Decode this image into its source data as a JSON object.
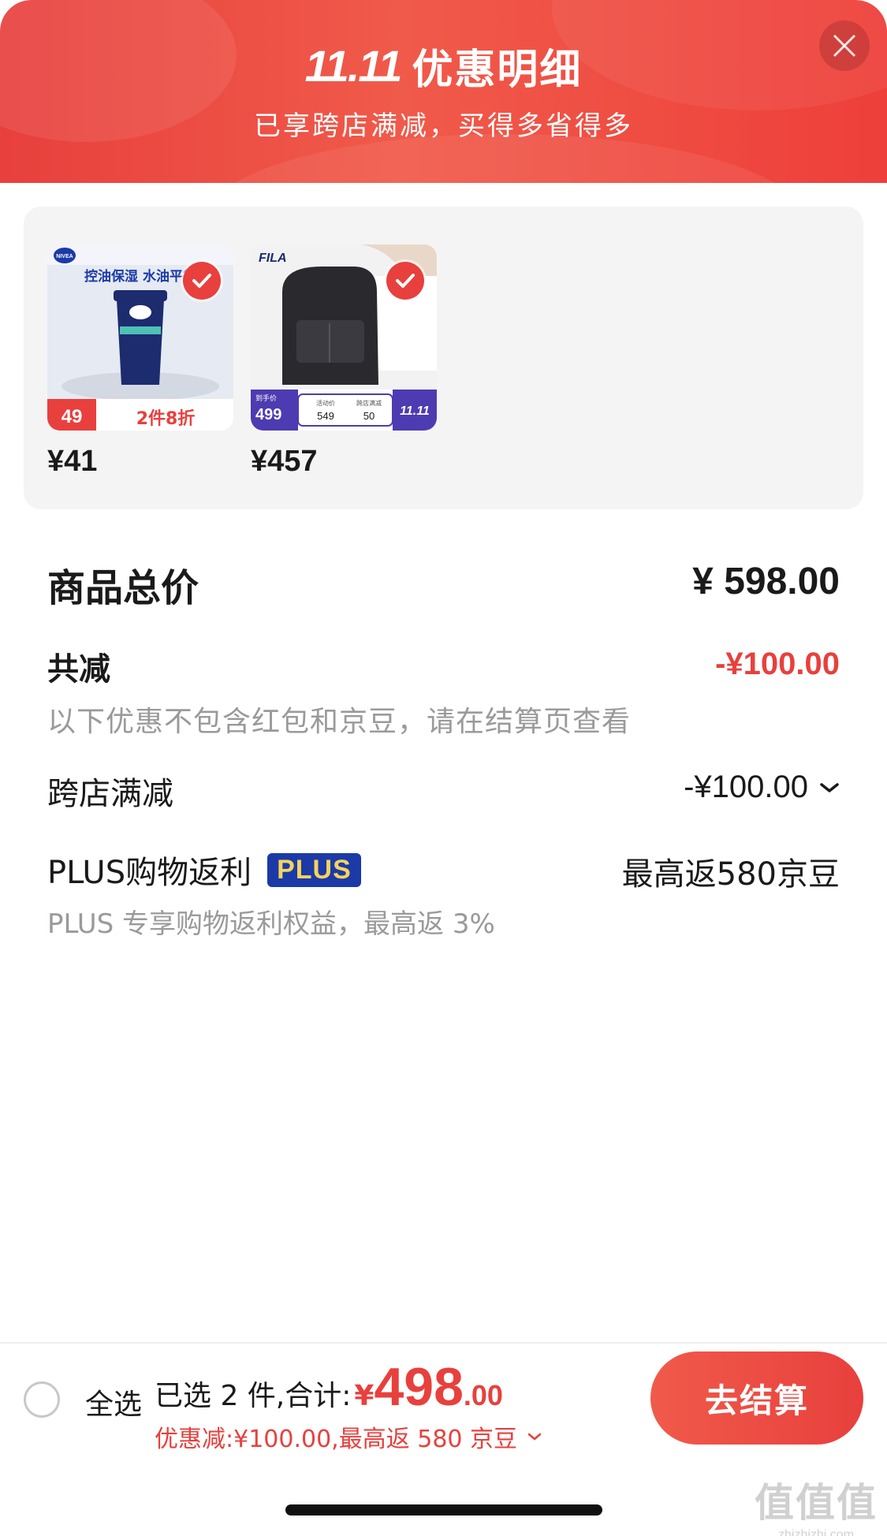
{
  "header": {
    "logo_text": "11.11",
    "title": "优惠明细",
    "subtitle": "已享跨店满减，买得多省得多",
    "close_icon": "close-icon"
  },
  "products": [
    {
      "name": "NIVEA MEN 控油保湿洗面奶",
      "thumb_text": {
        "brand": "NIVEA",
        "headline": "控油保湿 水油平衡",
        "badge_price": "49",
        "promo": "2件8折"
      },
      "price": "¥41",
      "checked": true
    },
    {
      "name": "FILA 双肩包",
      "thumb_text": {
        "brand": "FILA",
        "tag": "到手价",
        "badge_price": "499",
        "act_label": "活动价",
        "act_price": "549",
        "minus_label": "跨店满减",
        "minus_value": "50",
        "event": "11.11"
      },
      "price": "¥457",
      "checked": true
    }
  ],
  "summary": {
    "total_label": "商品总价",
    "total_value": "¥ 598.00",
    "reduce_label": "共减",
    "reduce_value": "-¥100.00",
    "reduce_note": "以下优惠不包含红包和京豆，请在结算页查看",
    "cross_label": "跨店满减",
    "cross_value": "-¥100.00",
    "plus_label": "PLUS购物返利",
    "plus_badge": "PLUS",
    "plus_value": "最高返580京豆",
    "plus_note": "PLUS 专享购物返利权益，最高返 3%"
  },
  "bottom_bar": {
    "select_all_label": "全选",
    "selected_text": "已选 2 件,合计:",
    "total_currency": "¥",
    "total_int": "498",
    "total_dec": ".00",
    "discount_note": "优惠减:¥100.00,最高返 580 京豆",
    "checkout_label": "去结算"
  },
  "watermark": {
    "big": "值值值",
    "small": "zhizhizhi.com"
  },
  "colors": {
    "accent": "#e8403d",
    "plus_badge_bg": "#1b3aa8",
    "plus_badge_text": "#f6d35b"
  }
}
